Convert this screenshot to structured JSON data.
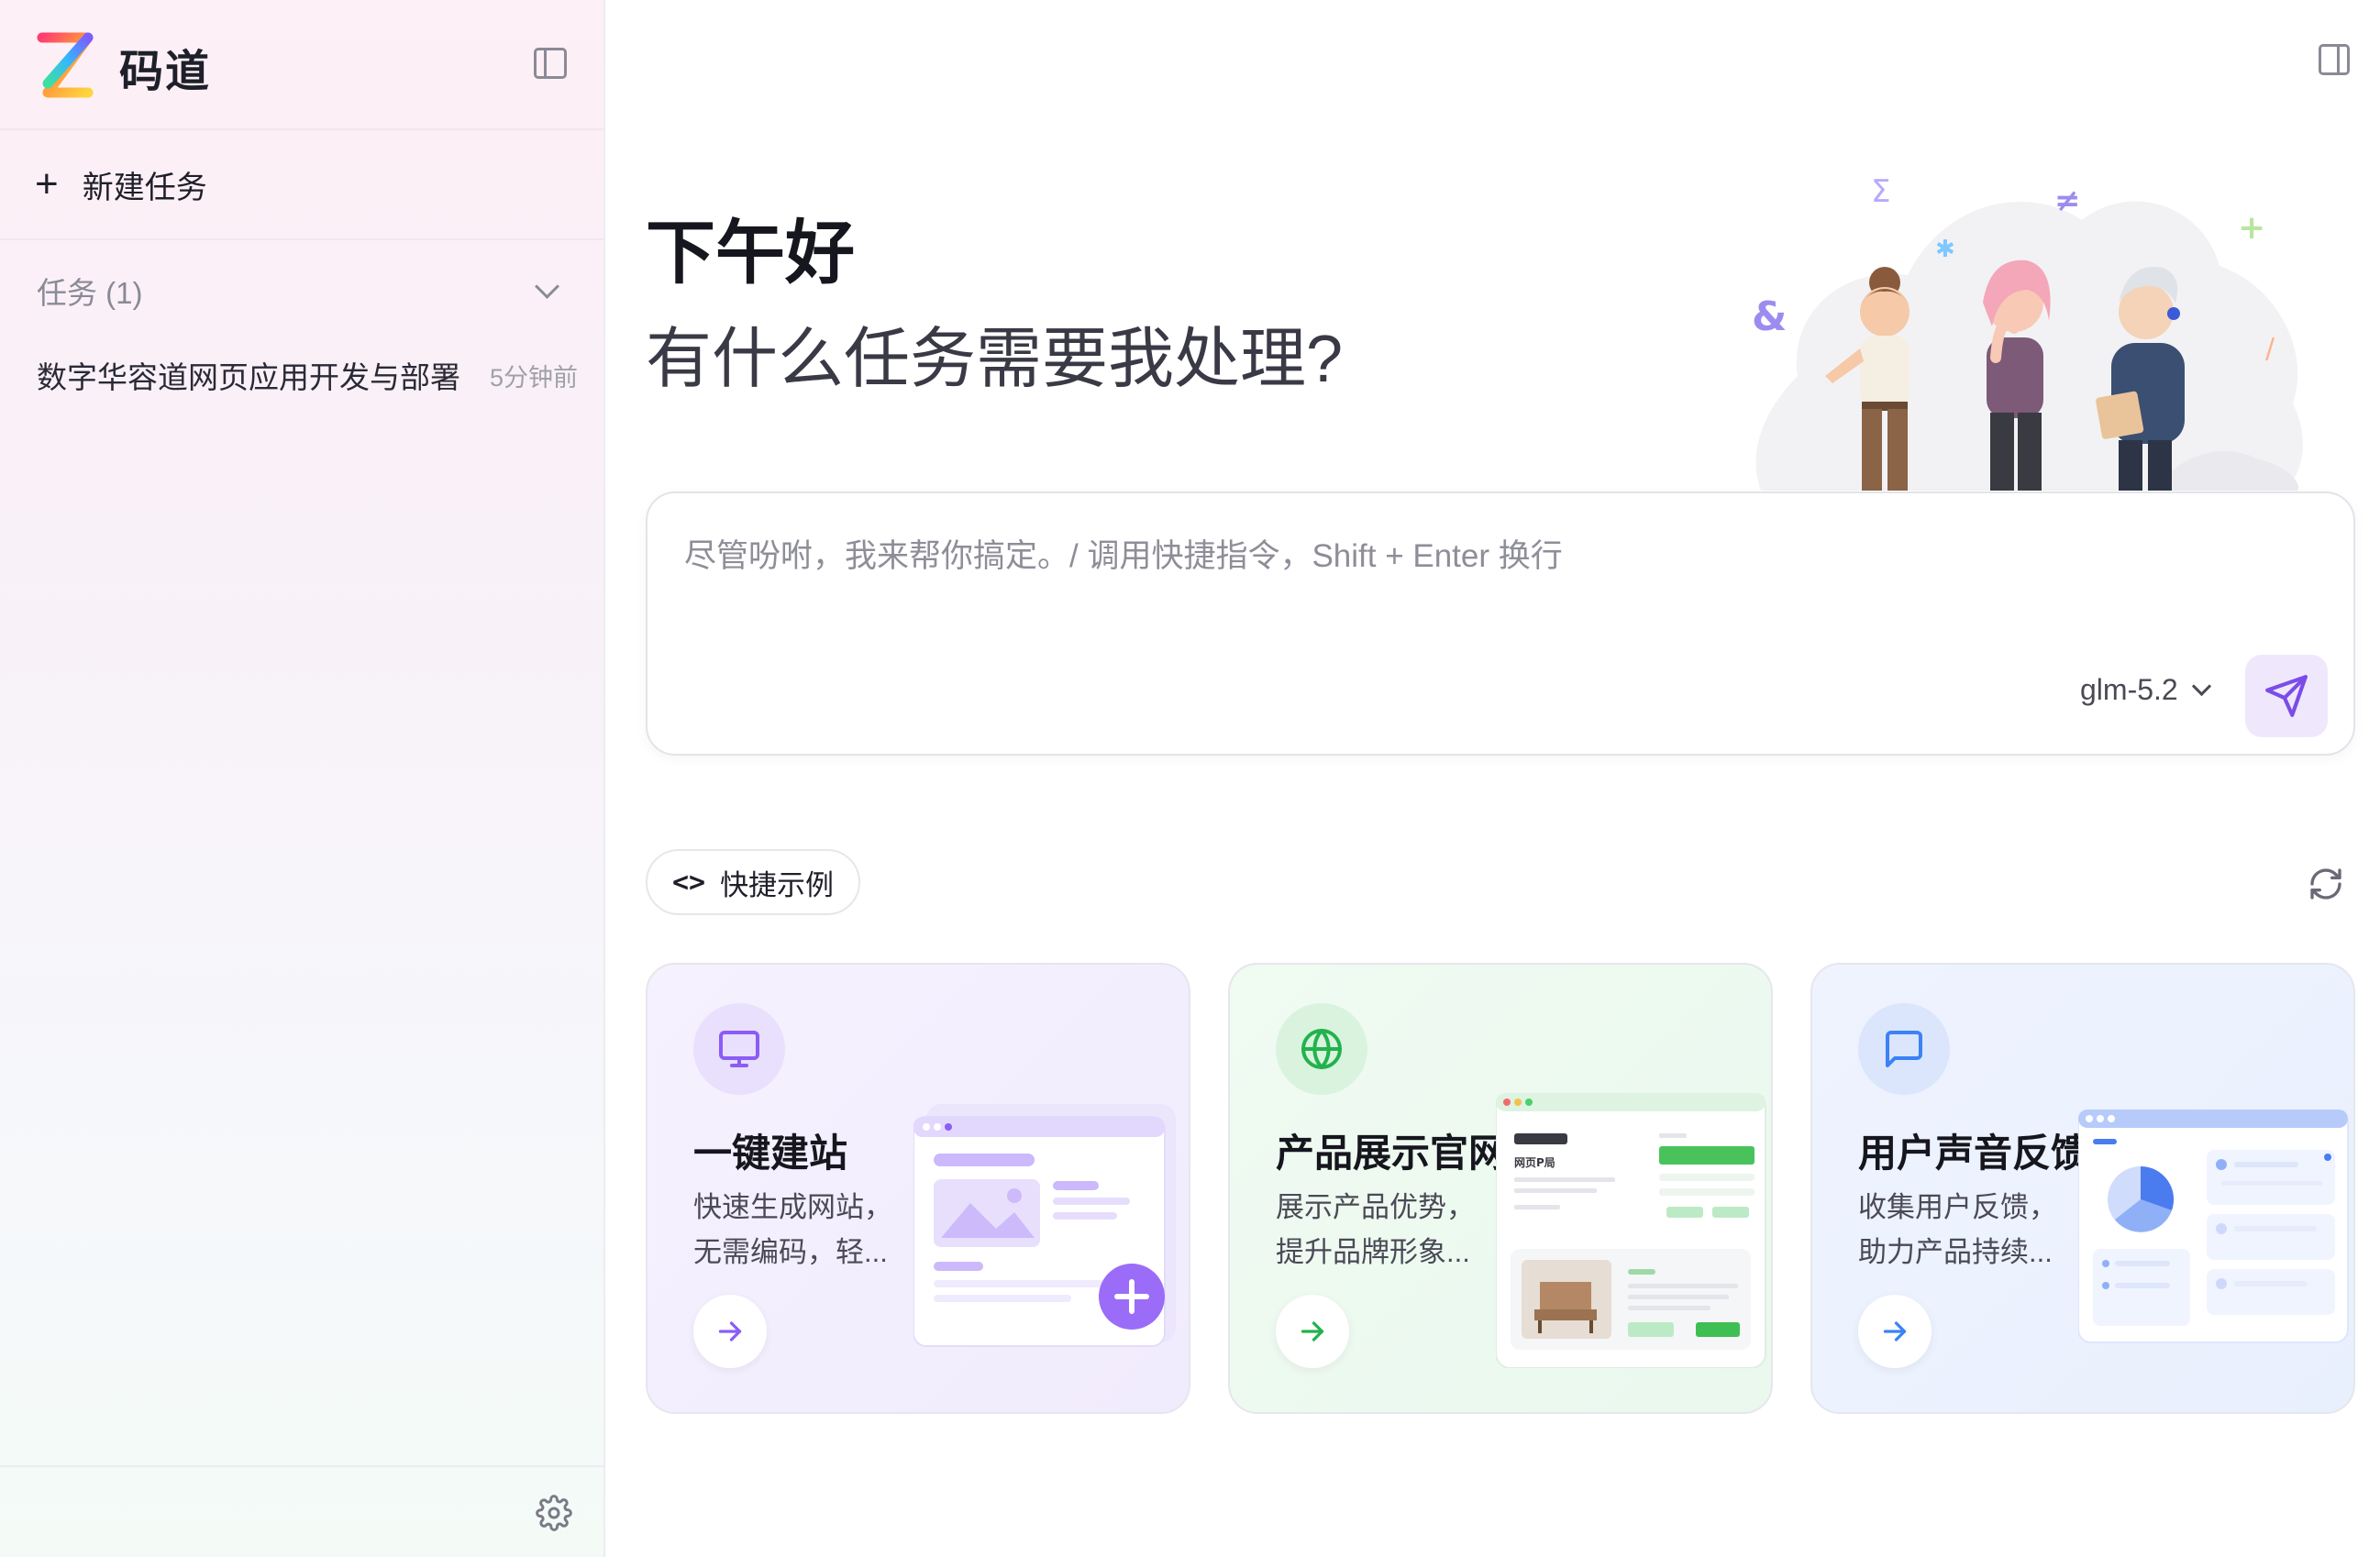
{
  "sidebar": {
    "brand": "码道",
    "new_task_label": "新建任务",
    "section_label": "任务 (1)",
    "tasks": [
      {
        "title": "数字华容道网页应用开发与部署",
        "time": "5分钟前"
      }
    ]
  },
  "main": {
    "greeting": "下午好",
    "subtitle": "有什么任务需要我处理?",
    "input": {
      "placeholder": "尽管吩咐，我来帮你搞定。/ 调用快捷指令，Shift + Enter 换行",
      "value": "",
      "model": "glm-5.2"
    },
    "examples": {
      "label": "快捷示例",
      "cards": [
        {
          "title": "一键建站",
          "desc": "快速生成网站，无需编码，轻...",
          "accent": "#8b5cf6",
          "icon": "monitor-icon"
        },
        {
          "title": "产品展示官网",
          "desc": "展示产品优势，提升品牌形象...",
          "accent": "#22b24c",
          "icon": "globe-icon"
        },
        {
          "title": "用户声音反馈",
          "desc": "收集用户反馈，助力产品持续...",
          "accent": "#3b82f6",
          "icon": "message-icon"
        }
      ]
    }
  },
  "illustrations": {
    "mock_brand": "网页P局"
  },
  "colors": {
    "accent": "#8b5cf6",
    "send_bg": "#efe8fd"
  }
}
